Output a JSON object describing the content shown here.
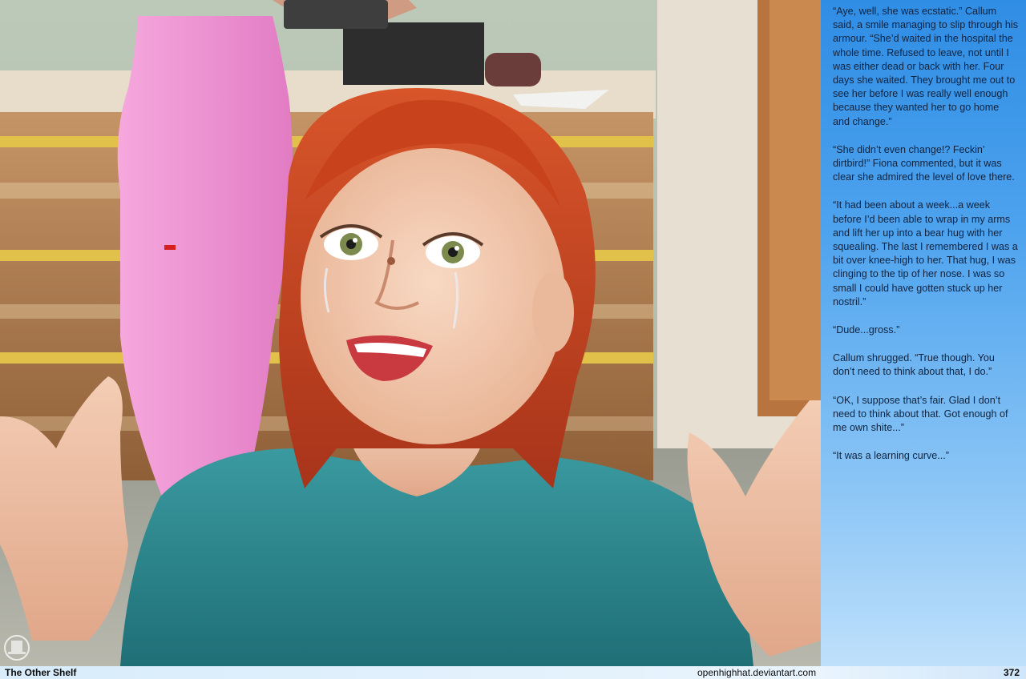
{
  "story": {
    "paragraphs": [
      "“Aye, well, she was ecstatic.” Callum said, a smile managing to slip through his armour. “She’d waited in the hospital the whole time. Refused to leave, not until I was either dead or back with her. Four days she waited. They brought me out to see her before I was really well enough because they wanted her to go home and change.”",
      "“She didn’t even change!? Feckin’ dirtbird!” Fiona commented, but it was clear she admired the level of love there.",
      "“It had been about a week...a week before I’d been able to wrap in my arms and lift her up into a bear hug with her squealing. The last I remembered I was a bit over knee-high to her. That hug, I was clinging to the tip of her nose. I was so small I could have gotten stuck up her nostril.”",
      "“Dude...gross.”",
      "Callum shrugged. “True though. You don’t need to think about that, I do.”",
      "“OK, I suppose that’s fair. Glad I don’t need to think about that. Got enough of me own shite...”",
      "“It was a learning curve...”"
    ]
  },
  "footer": {
    "title": "The Other Shelf",
    "site": "openhighhat.deviantart.com",
    "page_number": "372"
  },
  "colors": {
    "story_column_top": "#2f8de4",
    "story_column_bottom": "#bfe0fb",
    "hair": "#c8421c",
    "shirt": "#2f8a90",
    "scrubs": "#f08fd0",
    "counter_wood": "#b8865a"
  },
  "icons": {
    "watermark": "top-hat-logo"
  }
}
